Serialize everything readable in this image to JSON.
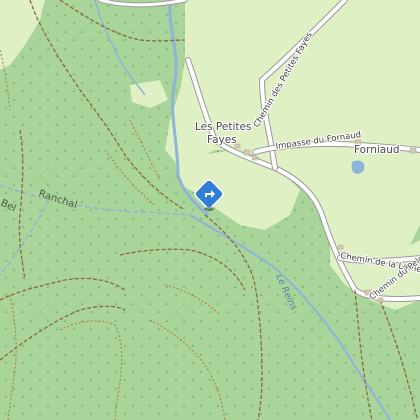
{
  "map": {
    "colors": {
      "forest": "#a9d49a",
      "meadow": "#dff0c4",
      "road": "#ffffff",
      "road_casing": "#9a9a9a",
      "water": "#8fb3d9",
      "track": "#8a6a3a",
      "path": "#b07840",
      "marker": "#2f7fd6"
    },
    "labels": {
      "place_les_petites_fayes_line1": "Les Petites",
      "place_les_petites_fayes_line2": "Fayes",
      "place_forniaud": "Forniaud",
      "road_chemin_des_petites_fayes": "Chemin des Petites Fayes",
      "road_impasse_du_fornaud": "Impasse du Fornaud",
      "road_chemin_de_la_lame": "Chemin de la Lame",
      "road_chemin_du_pelo": "Chemin du Pelo",
      "path_ranchal": "Ranchal",
      "path_bel": "Bel",
      "water_le_reins": "Le Reins"
    },
    "marker": {
      "icon": "direction-diamond-icon"
    }
  }
}
